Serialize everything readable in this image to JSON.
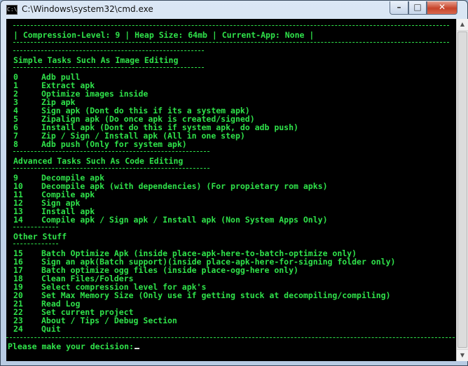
{
  "window": {
    "title": "C:\\Windows\\system32\\cmd.exe",
    "icon_label": "C:\\",
    "minimize_glyph": "–",
    "maximize_glyph": "□",
    "close_glyph": "✕"
  },
  "console": {
    "status_line": "| Compression-Level: 9 | Heap Size: 64mb | Current-App: None |",
    "sections": [
      {
        "heading": "Simple Tasks Such As Image Editing",
        "items": [
          {
            "num": "0",
            "label": "Adb pull"
          },
          {
            "num": "1",
            "label": "Extract apk"
          },
          {
            "num": "2",
            "label": "Optimize images inside"
          },
          {
            "num": "3",
            "label": "Zip apk"
          },
          {
            "num": "4",
            "label": "Sign apk (Dont do this if its a system apk)"
          },
          {
            "num": "5",
            "label": "Zipalign apk (Do once apk is created/signed)"
          },
          {
            "num": "6",
            "label": "Install apk (Dont do this if system apk, do adb push)"
          },
          {
            "num": "7",
            "label": "Zip / Sign / Install apk (All in one step)"
          },
          {
            "num": "8",
            "label": "Adb push (Only for system apk)"
          }
        ]
      },
      {
        "heading": "Advanced Tasks Such As Code Editing",
        "items": [
          {
            "num": "9",
            "label": "Decompile apk"
          },
          {
            "num": "10",
            "label": "Decompile apk (with dependencies) (For propietary rom apks)"
          },
          {
            "num": "11",
            "label": "Compile apk"
          },
          {
            "num": "12",
            "label": "Sign apk"
          },
          {
            "num": "13",
            "label": "Install apk"
          },
          {
            "num": "14",
            "label": "Compile apk / Sign apk / Install apk (Non System Apps Only)"
          }
        ]
      },
      {
        "heading": "Other Stuff",
        "items": [
          {
            "num": "15",
            "label": "Batch Optimize Apk (inside place-apk-here-to-batch-optimize only)"
          },
          {
            "num": "16",
            "label": "Sign an apk(Batch support)(inside place-apk-here-for-signing folder only)"
          },
          {
            "num": "17",
            "label": "Batch optimize ogg files (inside place-ogg-here only)"
          },
          {
            "num": "18",
            "label": "Clean Files/Folders"
          },
          {
            "num": "19",
            "label": "Select compression level for apk's"
          },
          {
            "num": "20",
            "label": "Set Max Memory Size (Only use if getting stuck at decompiling/compiling)"
          },
          {
            "num": "21",
            "label": "Read Log"
          },
          {
            "num": "22",
            "label": "Set current project"
          },
          {
            "num": "23",
            "label": "About / Tips / Debug Section"
          },
          {
            "num": "24",
            "label": "Quit"
          }
        ]
      }
    ],
    "prompt": "Please make your decision:"
  },
  "colors": {
    "console_text": "#2fe24a",
    "console_bg": "#000000"
  }
}
